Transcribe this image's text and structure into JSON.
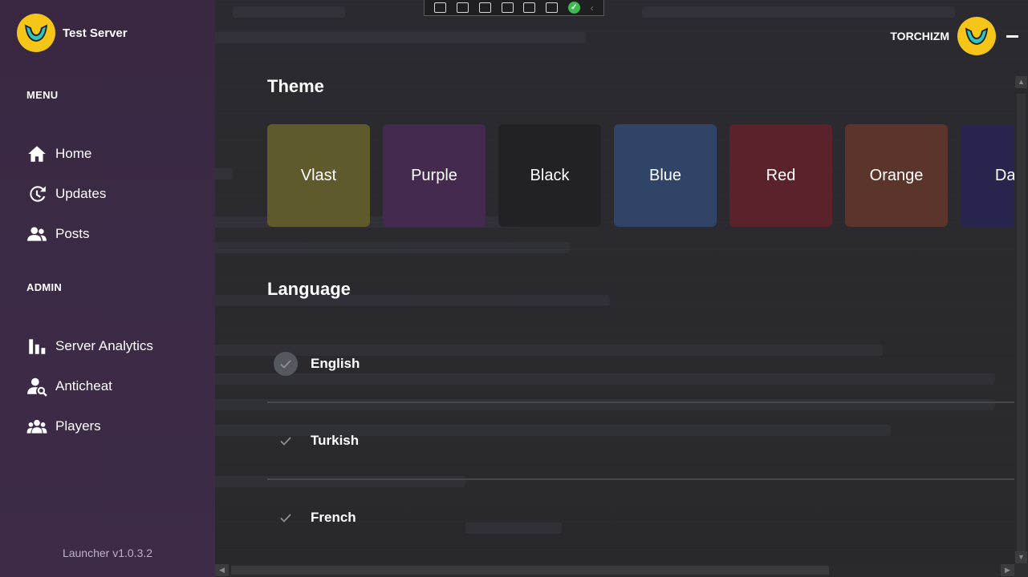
{
  "app": {
    "name": "Test Server",
    "version": "Launcher v1.0.3.2"
  },
  "user": {
    "name": "TORCHIZM"
  },
  "sidebar": {
    "menu_title": "MENU",
    "menu_items": [
      {
        "label": "Home",
        "icon": "home-icon"
      },
      {
        "label": "Updates",
        "icon": "history-icon"
      },
      {
        "label": "Posts",
        "icon": "users-icon"
      }
    ],
    "admin_title": "ADMIN",
    "admin_items": [
      {
        "label": "Server Analytics",
        "icon": "bar-chart-icon"
      },
      {
        "label": "Anticheat",
        "icon": "user-search-icon"
      },
      {
        "label": "Players",
        "icon": "group-icon"
      }
    ]
  },
  "theme_section": {
    "title": "Theme",
    "themes": [
      {
        "label": "Vlast",
        "color": "#5f5a2c"
      },
      {
        "label": "Purple",
        "color": "#452a4f"
      },
      {
        "label": "Black",
        "color": "#222226"
      },
      {
        "label": "Blue",
        "color": "#2f4466"
      },
      {
        "label": "Red",
        "color": "#5a232b"
      },
      {
        "label": "Orange",
        "color": "#5b352b"
      },
      {
        "label": "Dark",
        "color": "#27254e"
      }
    ]
  },
  "language_section": {
    "title": "Language",
    "languages": [
      {
        "label": "English",
        "selected": true
      },
      {
        "label": "Turkish",
        "selected": false
      },
      {
        "label": "French",
        "selected": false
      }
    ]
  },
  "colors": {
    "accent": "#f5c518",
    "sidebar": "#3b2a45",
    "background": "#2a2a2e"
  }
}
